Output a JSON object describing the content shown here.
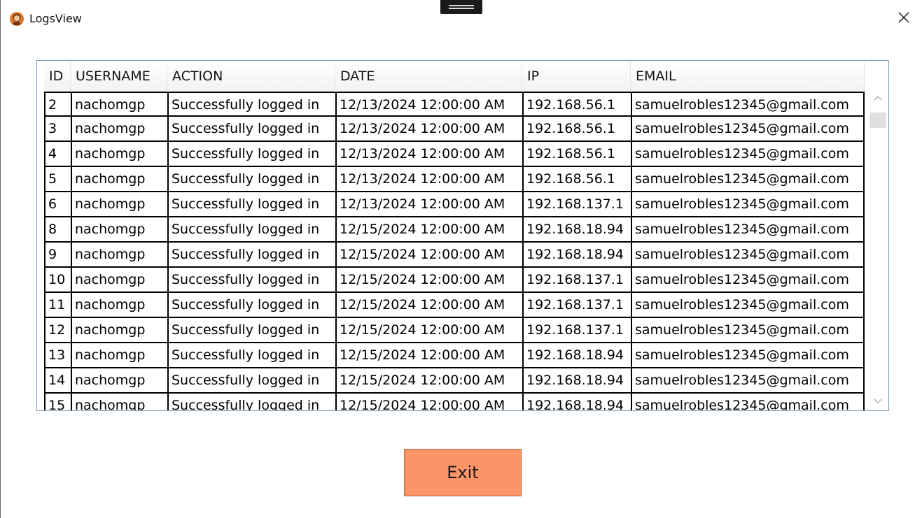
{
  "window": {
    "title": "LogsView",
    "icon": "app-avatar-icon",
    "close_icon": "close-icon"
  },
  "colors": {
    "exit_button": "#fd9468",
    "grid_border": "#7f9db9",
    "app_icon_orange": "#e07a2a"
  },
  "table": {
    "columns": [
      "ID",
      "USERNAME",
      "ACTION",
      "DATE",
      "IP",
      "EMAIL"
    ],
    "rows": [
      [
        "2",
        "nachomgp",
        "Successfully logged in",
        "12/13/2024 12:00:00 AM",
        "192.168.56.1",
        "samuelrobles12345@gmail.com"
      ],
      [
        "3",
        "nachomgp",
        "Successfully logged in",
        "12/13/2024 12:00:00 AM",
        "192.168.56.1",
        "samuelrobles12345@gmail.com"
      ],
      [
        "4",
        "nachomgp",
        "Successfully logged in",
        "12/13/2024 12:00:00 AM",
        "192.168.56.1",
        "samuelrobles12345@gmail.com"
      ],
      [
        "5",
        "nachomgp",
        "Successfully logged in",
        "12/13/2024 12:00:00 AM",
        "192.168.56.1",
        "samuelrobles12345@gmail.com"
      ],
      [
        "6",
        "nachomgp",
        "Successfully logged in",
        "12/13/2024 12:00:00 AM",
        "192.168.137.1",
        "samuelrobles12345@gmail.com"
      ],
      [
        "8",
        "nachomgp",
        "Successfully logged in",
        "12/15/2024 12:00:00 AM",
        "192.168.18.94",
        "samuelrobles12345@gmail.com"
      ],
      [
        "9",
        "nachomgp",
        "Successfully logged in",
        "12/15/2024 12:00:00 AM",
        "192.168.18.94",
        "samuelrobles12345@gmail.com"
      ],
      [
        "10",
        "nachomgp",
        "Successfully logged in",
        "12/15/2024 12:00:00 AM",
        "192.168.137.1",
        "samuelrobles12345@gmail.com"
      ],
      [
        "11",
        "nachomgp",
        "Successfully logged in",
        "12/15/2024 12:00:00 AM",
        "192.168.137.1",
        "samuelrobles12345@gmail.com"
      ],
      [
        "12",
        "nachomgp",
        "Successfully logged in",
        "12/15/2024 12:00:00 AM",
        "192.168.137.1",
        "samuelrobles12345@gmail.com"
      ],
      [
        "13",
        "nachomgp",
        "Successfully logged in",
        "12/15/2024 12:00:00 AM",
        "192.168.18.94",
        "samuelrobles12345@gmail.com"
      ],
      [
        "14",
        "nachomgp",
        "Successfully logged in",
        "12/15/2024 12:00:00 AM",
        "192.168.18.94",
        "samuelrobles12345@gmail.com"
      ],
      [
        "15",
        "nachomgp",
        "Successfully logged in",
        "12/15/2024 12:00:00 AM",
        "192.168.18.94",
        "samuelrobles12345@gmail.com"
      ]
    ]
  },
  "scrollbar": {
    "up_icon": "chevron-up-icon",
    "down_icon": "chevron-down-icon"
  },
  "exit_button": {
    "label": "Exit"
  }
}
